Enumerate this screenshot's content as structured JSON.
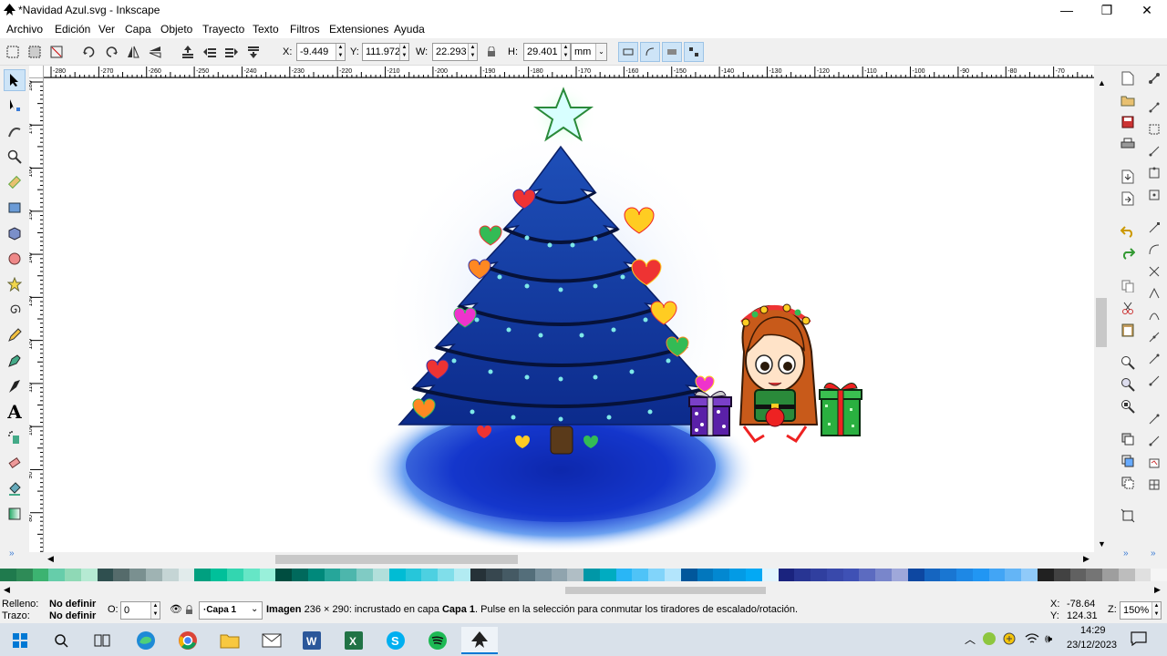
{
  "window": {
    "title": "*Navidad Azul.svg - Inkscape",
    "minimize": "—",
    "maximize": "❐",
    "close": "✕"
  },
  "menu": [
    "Archivo",
    "Edición",
    "Ver",
    "Capa",
    "Objeto",
    "Trayecto",
    "Texto",
    "Filtros",
    "Extensiones",
    "Ayuda"
  ],
  "toolbar": {
    "x_label": "X:",
    "x_value": "-9.449",
    "y_label": "Y:",
    "y_value": "111.972",
    "w_label": "W:",
    "w_value": "22.293",
    "h_label": "H:",
    "h_value": "29.401",
    "unit": "mm"
  },
  "ruler": {
    "h_ticks": [
      "-280",
      "-270",
      "-260",
      "-250",
      "-240",
      "-230",
      "-220",
      "-210",
      "-200",
      "-190",
      "-180",
      "-170",
      "-160",
      "-150",
      "-140",
      "-130",
      "-120",
      "-110",
      "-100",
      "-90",
      "-80",
      "-70"
    ],
    "v_ticks": [
      "180",
      "170",
      "160",
      "150",
      "140",
      "130",
      "120",
      "110",
      "100",
      "90",
      "80"
    ]
  },
  "status": {
    "fill_label": "Relleno:",
    "fill_value": "No definir",
    "stroke_label": "Trazo:",
    "stroke_value": "No definir",
    "opacity_label": "O:",
    "opacity_value": "0",
    "layer": "·Capa 1",
    "message_bold": "Imagen",
    "message": "236 × 290: incrustado en capa",
    "message_layer": "Capa 1",
    "message_tail": ". Pulse en la selección para conmutar los tiradores de escalado/rotación.",
    "x_label": "X:",
    "x_coord": "-78.64",
    "y_label": "Y:",
    "y_coord": "124.31",
    "zoom_label": "Z:",
    "zoom": "150%"
  },
  "taskbar": {
    "time": "14:29",
    "date": "23/12/2023"
  },
  "palette": [
    "#1f7a4d",
    "#2e8b57",
    "#3cb371",
    "#66cdaa",
    "#8fd9b6",
    "#b6ead3",
    "#2f4f4f",
    "#556b6b",
    "#7a9090",
    "#9fb3b3",
    "#c5d5d5",
    "#e1ebeb",
    "#00a080",
    "#00c09a",
    "#33d6b0",
    "#66e6c6",
    "#99f0da",
    "#004d40",
    "#00695c",
    "#00897b",
    "#26a69a",
    "#4db6ac",
    "#80cbc4",
    "#b2dfdb",
    "#00bcd4",
    "#26c6da",
    "#4dd0e1",
    "#80deea",
    "#b2ebf2",
    "#263238",
    "#37474f",
    "#455a64",
    "#546e7a",
    "#78909c",
    "#90a4ae",
    "#b0bec5",
    "#0097a7",
    "#00acc1",
    "#29b6f6",
    "#4fc3f7",
    "#81d4fa",
    "#b3e5fc",
    "#01579b",
    "#0277bd",
    "#0288d1",
    "#039be5",
    "#03a9f4",
    "#e1f5fe",
    "#1a237e",
    "#283593",
    "#303f9f",
    "#3949ab",
    "#3f51b5",
    "#5c6bc0",
    "#7986cb",
    "#9fa8da",
    "#0d47a1",
    "#1565c0",
    "#1976d2",
    "#1e88e5",
    "#2196f3",
    "#42a5f5",
    "#64b5f6",
    "#90caf9",
    "#212121",
    "#424242",
    "#616161",
    "#757575",
    "#9e9e9e",
    "#bdbdbd",
    "#e0e0e0",
    "#f5f5f5"
  ]
}
